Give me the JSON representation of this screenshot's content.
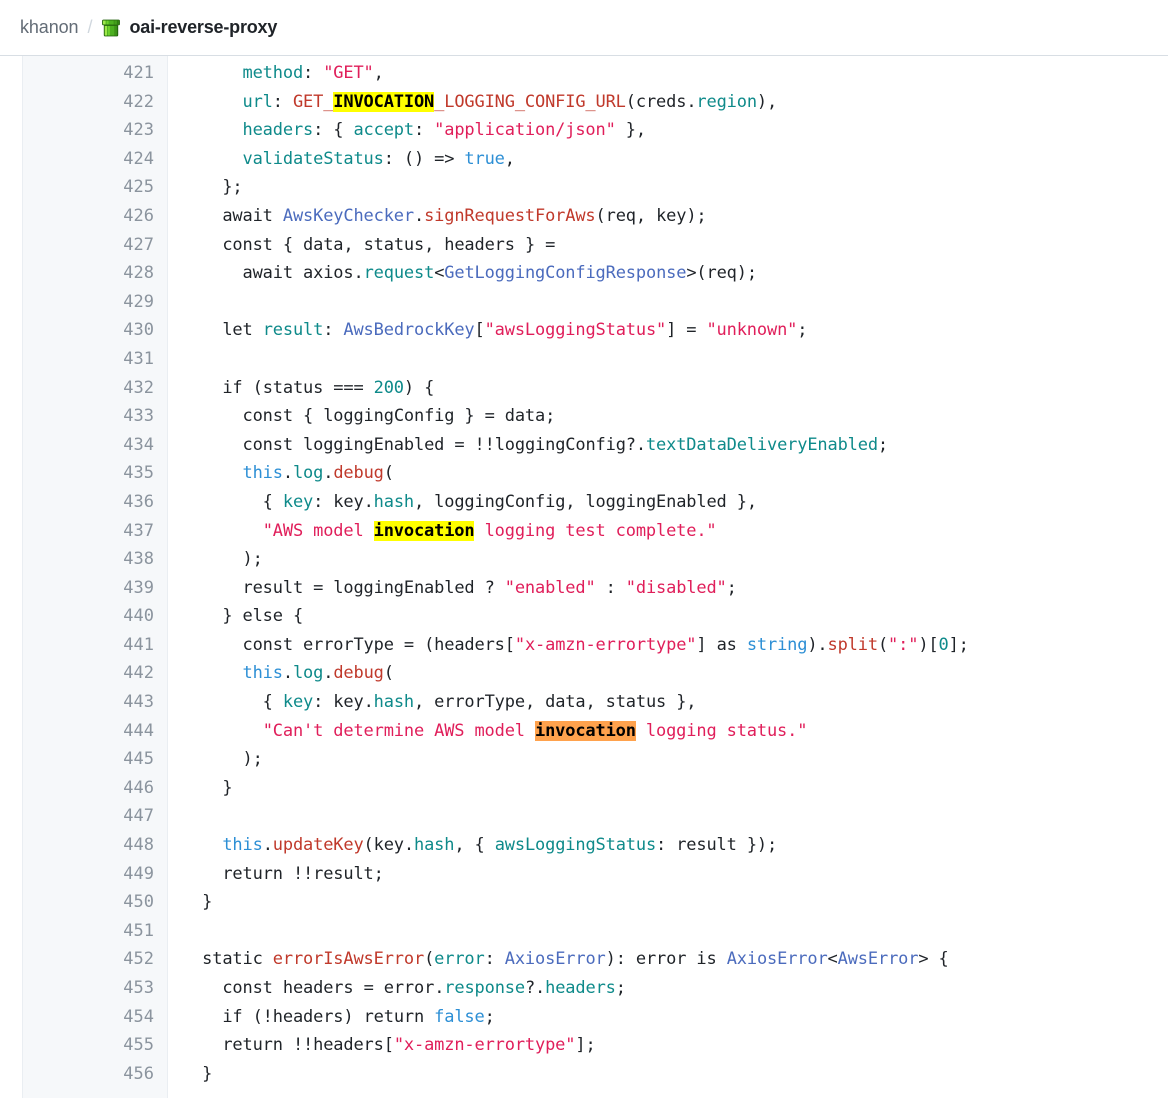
{
  "header": {
    "owner": "khanon",
    "separator": "/",
    "repo": "oai-reverse-proxy",
    "repo_emoji": "pipe-icon",
    "emoji_colors": {
      "light": "#7ed321",
      "mid": "#4caf20",
      "dark": "#2e7d12"
    }
  },
  "search": {
    "term": "invocation",
    "highlight_color": "#ffff00",
    "active_highlight_color": "#ffa24d"
  },
  "code": {
    "language": "typescript",
    "first_line": 421,
    "last_line": 456,
    "line_numbers": [
      "421",
      "422",
      "423",
      "424",
      "425",
      "426",
      "427",
      "428",
      "429",
      "430",
      "431",
      "432",
      "433",
      "434",
      "435",
      "436",
      "437",
      "438",
      "439",
      "440",
      "441",
      "442",
      "443",
      "444",
      "445",
      "446",
      "447",
      "448",
      "449",
      "450",
      "451",
      "452",
      "453",
      "454",
      "455",
      "456"
    ],
    "lines": [
      "      method: \"GET\",",
      "      url: GET_INVOCATION_LOGGING_CONFIG_URL(creds.region),",
      "      headers: { accept: \"application/json\" },",
      "      validateStatus: () => true,",
      "    };",
      "    await AwsKeyChecker.signRequestForAws(req, key);",
      "    const { data, status, headers } =",
      "      await axios.request<GetLoggingConfigResponse>(req);",
      "",
      "    let result: AwsBedrockKey[\"awsLoggingStatus\"] = \"unknown\";",
      "",
      "    if (status === 200) {",
      "      const { loggingConfig } = data;",
      "      const loggingEnabled = !!loggingConfig?.textDataDeliveryEnabled;",
      "      this.log.debug(",
      "        { key: key.hash, loggingConfig, loggingEnabled },",
      "        \"AWS model invocation logging test complete.\"",
      "      );",
      "      result = loggingEnabled ? \"enabled\" : \"disabled\";",
      "    } else {",
      "      const errorType = (headers[\"x-amzn-errortype\"] as string).split(\":\")[0];",
      "      this.log.debug(",
      "        { key: key.hash, errorType, data, status },",
      "        \"Can't determine AWS model invocation logging status.\"",
      "      );",
      "    }",
      "",
      "    this.updateKey(key.hash, { awsLoggingStatus: result });",
      "    return !!result;",
      "  }",
      "",
      "  static errorIsAwsError(error: AxiosError): error is AxiosError<AwsError> {",
      "    const headers = error.response?.headers;",
      "    if (!headers) return false;",
      "    return !!headers[\"x-amzn-errortype\"];",
      "  }"
    ]
  }
}
